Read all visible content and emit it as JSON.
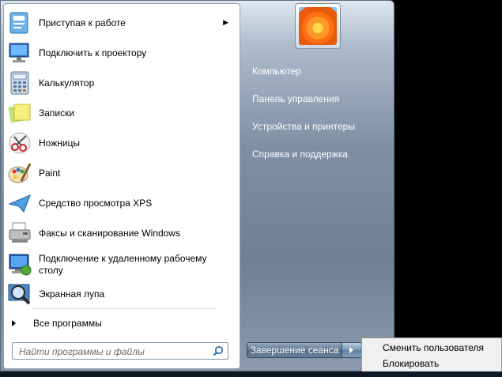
{
  "programs": [
    {
      "label": "Приступая к работе",
      "icon": "getting-started-icon",
      "has_submenu": true
    },
    {
      "label": "Подключить к проектору",
      "icon": "projector-icon"
    },
    {
      "label": "Калькулятор",
      "icon": "calculator-icon"
    },
    {
      "label": "Записки",
      "icon": "sticky-notes-icon"
    },
    {
      "label": "Ножницы",
      "icon": "snipping-tool-icon"
    },
    {
      "label": "Paint",
      "icon": "paint-icon"
    },
    {
      "label": "Средство просмотра XPS",
      "icon": "xps-viewer-icon"
    },
    {
      "label": "Факсы и сканирование Windows",
      "icon": "fax-scan-icon"
    },
    {
      "label": "Подключение к удаленному рабочему столу",
      "icon": "remote-desktop-icon"
    },
    {
      "label": "Экранная лупа",
      "icon": "magnifier-icon"
    }
  ],
  "all_programs_label": "Все программы",
  "search": {
    "placeholder": "Найти программы и файлы",
    "value": ""
  },
  "right_links": [
    "Компьютер",
    "Панель управления",
    "Устройства и принтеры",
    "Справка и поддержка"
  ],
  "shutdown_label": "Завершение сеанса",
  "shutdown_menu": [
    "Сменить пользователя",
    "Блокировать"
  ],
  "colors": {
    "menu_gradient_top": "#dfe7ef",
    "menu_gradient_mid": "#6f8094",
    "right_link_text": "#ffffff"
  }
}
